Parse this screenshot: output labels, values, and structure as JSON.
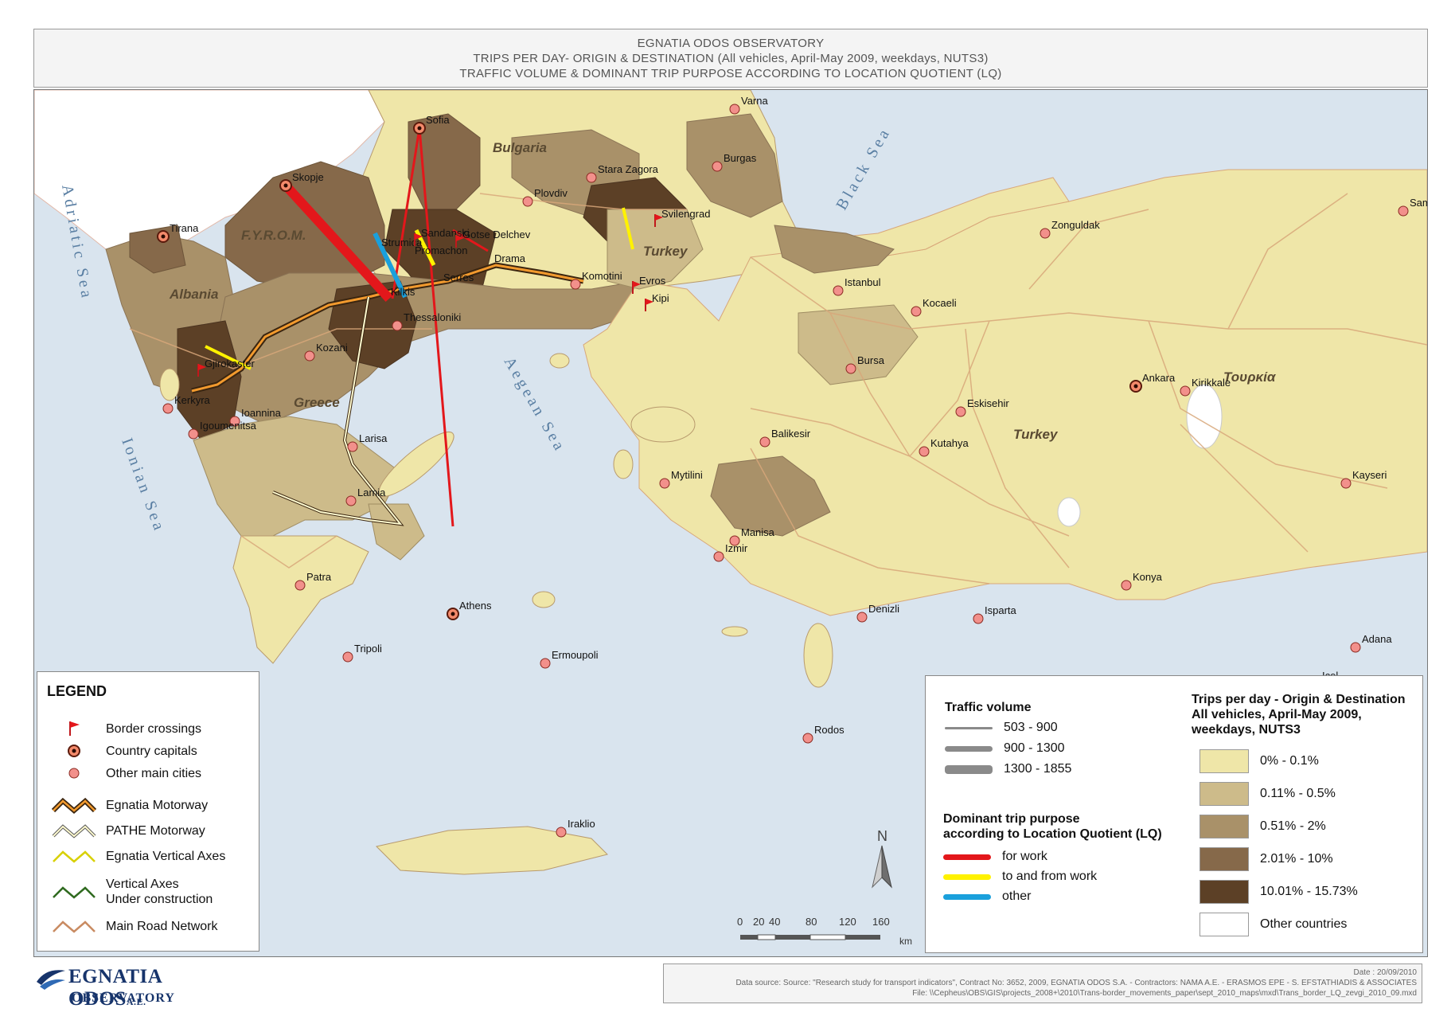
{
  "title": {
    "line1": "EGNATIA ODOS OBSERVATORY",
    "line2": "TRIPS PER DAY- ORIGIN & DESTINATION (All vehicles, April-May 2009, weekdays, NUTS3)",
    "line3": "TRAFFIC VOLUME & DOMINANT TRIP PURPOSE ACCORDING TO LOCATION QUOTIENT (LQ)"
  },
  "colors": {
    "sea": "#d9e4ee",
    "other_countries": "#ffffff",
    "class1": "#efe6a8",
    "class2": "#cdbb8a",
    "class3": "#a99169",
    "class4": "#86694a",
    "class5": "#5c4026",
    "for_work": "#e3171b",
    "to_and_from_work": "#fff200",
    "other": "#1aa0dc",
    "road": "#d8a77a"
  },
  "seas": [
    "Adriatic Sea",
    "Ionian Sea",
    "Aegean Sea",
    "Black Sea"
  ],
  "countries": [
    {
      "name": "Bulgaria"
    },
    {
      "name": "F.Y.R.O.M."
    },
    {
      "name": "Albania"
    },
    {
      "name": "Greece"
    },
    {
      "name": "Turkey"
    },
    {
      "name": "Turkey"
    },
    {
      "name": "Τουρκία"
    }
  ],
  "cities": [
    {
      "name": "Varna"
    },
    {
      "name": "Sofia"
    },
    {
      "name": "Burgas"
    },
    {
      "name": "Stara Zagora"
    },
    {
      "name": "Plovdiv"
    },
    {
      "name": "Skopje"
    },
    {
      "name": "Svilengrad"
    },
    {
      "name": "Samsun"
    },
    {
      "name": "Zonguldak"
    },
    {
      "name": "Tirana"
    },
    {
      "name": "Strumica"
    },
    {
      "name": "Sandanski"
    },
    {
      "name": "Gotse Delchev"
    },
    {
      "name": "Promachon"
    },
    {
      "name": "Drama"
    },
    {
      "name": "Serres"
    },
    {
      "name": "Kilkis"
    },
    {
      "name": "Komotini"
    },
    {
      "name": "Evros"
    },
    {
      "name": "Kipi"
    },
    {
      "name": "Istanbul"
    },
    {
      "name": "Kocaeli"
    },
    {
      "name": "Thessaloniki"
    },
    {
      "name": "Kozani"
    },
    {
      "name": "Bursa"
    },
    {
      "name": "Ankara"
    },
    {
      "name": "Kirikkale"
    },
    {
      "name": "Gjirokaster"
    },
    {
      "name": "Eskisehir"
    },
    {
      "name": "Kerkyra"
    },
    {
      "name": "Ioannina"
    },
    {
      "name": "Larisa"
    },
    {
      "name": "Balikesir"
    },
    {
      "name": "Kutahya"
    },
    {
      "name": "Igoumenitsa"
    },
    {
      "name": "Mytilini"
    },
    {
      "name": "Kayseri"
    },
    {
      "name": "Lamia"
    },
    {
      "name": "Manisa"
    },
    {
      "name": "Izmir"
    },
    {
      "name": "Patra"
    },
    {
      "name": "Athens"
    },
    {
      "name": "Konya"
    },
    {
      "name": "Denizli"
    },
    {
      "name": "Isparta"
    },
    {
      "name": "Adana"
    },
    {
      "name": "Tripoli"
    },
    {
      "name": "Ermoupoli"
    },
    {
      "name": "Icel"
    },
    {
      "name": "Rodos"
    },
    {
      "name": "Iraklio"
    }
  ],
  "flows": [
    {
      "from": "Skopje",
      "to": "Thessaloniki",
      "purpose": "for work",
      "volume_class": "1300 - 1855"
    },
    {
      "from": "Sofia",
      "to": "Thessaloniki",
      "purpose": "for work",
      "volume_class": "503 - 900"
    },
    {
      "from": "Sofia",
      "to": "Athens",
      "purpose": "for work",
      "volume_class": "503 - 900"
    },
    {
      "from": "Strumica",
      "to": "Thessaloniki",
      "purpose": "other",
      "volume_class": "900 - 1300"
    },
    {
      "from": "Sandanski",
      "to": "Serres",
      "purpose": "to and from work",
      "volume_class": "900 - 1300"
    },
    {
      "from": "Gotse Delchev",
      "to": "Drama",
      "purpose": "for work",
      "volume_class": "503 - 900"
    },
    {
      "from": "Svilengrad",
      "to": "Evros",
      "purpose": "to and from work",
      "volume_class": "503 - 900"
    },
    {
      "from": "Gjirokaster",
      "to": "Ioannina",
      "purpose": "to and from work",
      "volume_class": "503 - 900"
    }
  ],
  "legend": {
    "title": "LEGEND",
    "items": [
      {
        "label": "Border crossings",
        "icon": "border-crossing-flag-icon"
      },
      {
        "label": "Country capitals",
        "icon": "country-capital-icon"
      },
      {
        "label": "Other main cities",
        "icon": "main-city-icon"
      },
      {
        "label": "Egnatia Motorway",
        "icon": "egnatia-motorway-icon"
      },
      {
        "label": "PATHE Motorway",
        "icon": "pathe-motorway-icon"
      },
      {
        "label": "Egnatia Vertical Axes",
        "icon": "vertical-axes-icon"
      },
      {
        "label_line1": "Vertical Axes",
        "label_line2": "Under construction",
        "icon": "vertical-axes-construction-icon"
      },
      {
        "label": "Main Road Network",
        "icon": "main-road-icon"
      }
    ]
  },
  "traffic_legend": {
    "title": "Traffic volume",
    "classes": [
      "503 - 900",
      "900 - 1300",
      "1300 - 1855"
    ]
  },
  "purpose_legend": {
    "title_line1": "Dominant trip purpose",
    "title_line2": "according to Location Quotient (LQ)",
    "items": [
      "for work",
      "to and from work",
      "other"
    ]
  },
  "trips_legend": {
    "title_line1": "Trips per day - Origin & Destination",
    "title_line2": "All vehicles, April-May 2009,",
    "title_line3": "weekdays, NUTS3",
    "classes": [
      "0% - 0.1%",
      "0.11% - 0.5%",
      "0.51% - 2%",
      "2.01% - 10%",
      "10.01% - 15.73%",
      "Other countries"
    ]
  },
  "scale": {
    "ticks": [
      "0",
      "20",
      "40",
      "80",
      "120",
      "160"
    ],
    "unit": "km"
  },
  "north": "N",
  "footer": {
    "date": "Date : 20/09/2010",
    "source": "Data source: Source: \"Research study for transport indicators\", Contract No: 3652, 2009, EGNATIA ODOS S.A. - Contractors: NAMA A.E. - ERASMOS EPE - S. EFSTATHIADIS & ASSOCIATES",
    "file": "File: \\\\Cepheus\\OBS\\GIS\\projects_2008+\\2010\\Trans-border_movements_paper\\sept_2010_maps\\mxd\\Trans_border_LQ_zevgi_2010_09.mxd"
  },
  "logo": {
    "name": "EGNATIA ODOS",
    "suffix": "A.E.",
    "sub": "OBSERVATORY"
  }
}
